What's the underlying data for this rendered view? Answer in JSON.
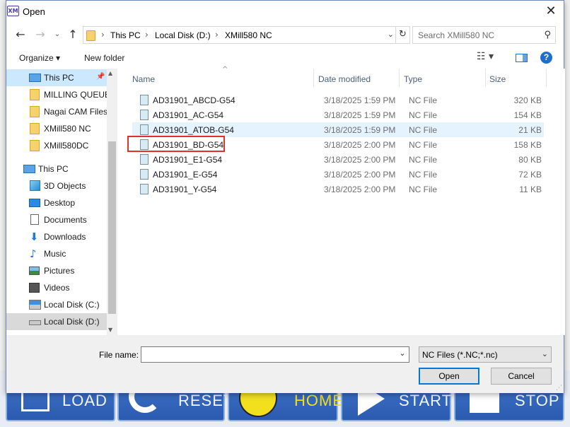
{
  "window": {
    "title": "Open",
    "icon_text": "XM"
  },
  "address": {
    "crumbs": [
      "This PC",
      "Local Disk (D:)",
      "XMill580 NC"
    ],
    "search_placeholder": "Search XMill580 NC"
  },
  "toolbar": {
    "organize": "Organize ▾",
    "new_folder": "New folder"
  },
  "sidebar": {
    "items": [
      {
        "label": "This PC",
        "icon": "pc-icon"
      },
      {
        "label": "MILLING QUEUE",
        "icon": "folder-icon"
      },
      {
        "label": "Nagai CAM Files",
        "icon": "folder-icon"
      },
      {
        "label": "XMill580 NC",
        "icon": "folder-icon"
      },
      {
        "label": "XMill580DC",
        "icon": "folder-icon"
      },
      {
        "label": "This PC",
        "icon": "pc-icon"
      },
      {
        "label": "3D Objects",
        "icon": "3d-objects-icon"
      },
      {
        "label": "Desktop",
        "icon": "desktop-icon"
      },
      {
        "label": "Documents",
        "icon": "documents-icon"
      },
      {
        "label": "Downloads",
        "icon": "downloads-icon"
      },
      {
        "label": "Music",
        "icon": "music-icon"
      },
      {
        "label": "Pictures",
        "icon": "pictures-icon"
      },
      {
        "label": "Videos",
        "icon": "videos-icon"
      },
      {
        "label": "Local Disk (C:)",
        "icon": "drive-c-icon"
      },
      {
        "label": "Local Disk (D:)",
        "icon": "drive-icon"
      }
    ]
  },
  "columns": {
    "name": "Name",
    "date": "Date modified",
    "type": "Type",
    "size": "Size"
  },
  "files": [
    {
      "name": "AD31901_ABCD-G54",
      "date": "3/18/2025 1:59 PM",
      "type": "NC File",
      "size": "320 KB"
    },
    {
      "name": "AD31901_AC-G54",
      "date": "3/18/2025 1:59 PM",
      "type": "NC File",
      "size": "154 KB"
    },
    {
      "name": "AD31901_ATOB-G54",
      "date": "3/18/2025 1:59 PM",
      "type": "NC File",
      "size": "21 KB"
    },
    {
      "name": "AD31901_BD-G54",
      "date": "3/18/2025 2:00 PM",
      "type": "NC File",
      "size": "158 KB"
    },
    {
      "name": "AD31901_E1-G54",
      "date": "3/18/2025 2:00 PM",
      "type": "NC File",
      "size": "80 KB"
    },
    {
      "name": "AD31901_E-G54",
      "date": "3/18/2025 2:00 PM",
      "type": "NC File",
      "size": "72 KB"
    },
    {
      "name": "AD31901_Y-G54",
      "date": "3/18/2025 2:00 PM",
      "type": "NC File",
      "size": "11 KB"
    }
  ],
  "bottom": {
    "file_name_label": "File name:",
    "file_name_value": "",
    "filter": "NC Files (*.NC;*.nc)",
    "open": "Open",
    "cancel": "Cancel"
  },
  "background_buttons": {
    "load": "LOAD",
    "reset": "RESET",
    "home": "HOME",
    "start": "START",
    "stop": "STOP"
  },
  "colors": {
    "accent": "#0078d7",
    "highlight": "#e03030",
    "bg_button": "#2b5bb0"
  }
}
